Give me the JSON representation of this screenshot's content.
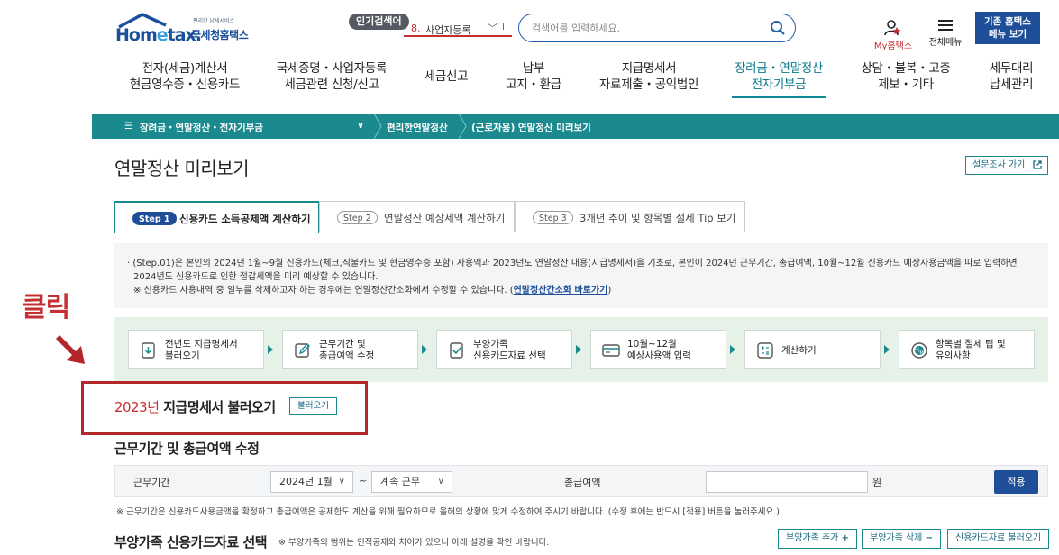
{
  "header": {
    "logo_word": "Hometax",
    "logo_kr": "국세청홈택스",
    "logo_tagline": "편리한 납세서비스",
    "popular_badge": "인기검색어",
    "popular_rank": "8.",
    "popular_term": "사업자등록",
    "search_placeholder": "검색어를 입력하세요.",
    "my_home": "My홈택스",
    "all_menu": "전체메뉴",
    "old_menu_line1": "기존 홈택스",
    "old_menu_line2": "메뉴 보기"
  },
  "nav": [
    {
      "l1": "전자(세금)계산서",
      "l2": "현금영수증・신용카드"
    },
    {
      "l1": "국세증명・사업자등록",
      "l2": "세금관련 신청/신고"
    },
    {
      "l1": "세금신고",
      "l2": ""
    },
    {
      "l1": "납부",
      "l2": "고지・환급"
    },
    {
      "l1": "지급명세서",
      "l2": "자료제출・공익법인"
    },
    {
      "l1": "장려금・연말정산",
      "l2": "전자기부금"
    },
    {
      "l1": "상담・불복・고충",
      "l2": "제보・기타"
    },
    {
      "l1": "세무대리",
      "l2": "납세관리"
    }
  ],
  "breadcrumb": {
    "menu": "장려금・연말정산・전자기부금",
    "item2": "편리한연말정산",
    "item3": "(근로자용) 연말정산 미리보기"
  },
  "page": {
    "title": "연말정산 미리보기",
    "survey": "설문조사 가기"
  },
  "tabs": [
    {
      "step": "Step 1",
      "label": "신용카드 소득공제액 계산하기"
    },
    {
      "step": "Step 2",
      "label": "연말정산 예상세액 계산하기"
    },
    {
      "step": "Step 3",
      "label": "3개년 추이 및 항목별 절세 Tip 보기"
    }
  ],
  "info": {
    "line1": "(Step.01)은 본인의 2024년 1월~9월 신용카드(체크,직불카드 및 현금영수증 포함) 사용액과 2023년도 연말정산 내용(지급명세서)을 기초로, 본인이 2024년 근무기간, 총급여액, 10월~12월 신용카드 예상사용금액을 따로 입력하면",
    "line2": "2024년도 신용카드로 인한 절감세액을 미리 예상할 수 있습니다.",
    "line3": "※ 신용카드 사용내역 중 일부를 삭제하고자 하는 경우에는 연말정산간소화에서 수정할 수 있습니다.",
    "link": "연말정산간소화 바로가기"
  },
  "annotation": {
    "text": "클릭"
  },
  "steps": [
    {
      "l1": "전년도 지급명세서",
      "l2": "불러오기"
    },
    {
      "l1": "근무기간 및",
      "l2": "총급여액 수정"
    },
    {
      "l1": "부양가족",
      "l2": "신용카드자료 선택"
    },
    {
      "l1": "10월~12월",
      "l2": "예상사용액 입력"
    },
    {
      "l1": "계산하기",
      "l2": ""
    },
    {
      "l1": "항목별 절세 팁 및",
      "l2": "유의사항"
    }
  ],
  "section1": {
    "year": "2023년",
    "title": "지급명세서 불러오기",
    "button": "불러오기"
  },
  "section2": {
    "title": "근무기간 및 총급여액 수정",
    "period_label": "근무기간",
    "start_value": "2024년 1월",
    "tilde": "~",
    "end_value": "계속 근무",
    "salary_label": "총급여액",
    "salary_value": "",
    "unit": "원",
    "apply": "적용",
    "note": "※ 근무기간은 신용카드사용금액을 확정하고 총급여액은 공제한도 계산을 위해 필요하므로 올해의 상황에 맞게 수정하여 주시기 바랍니다. (수정 후에는 반드시 [적용] 버튼을 눌러주세요.)"
  },
  "section3": {
    "title": "부양가족 신용카드자료 선택",
    "note": "※ 부양가족의 범위는 인적공제와 차이가 있으니 아래 설명을 확인 바랍니다.",
    "add": "부양가족 추가",
    "del": "부양가족 삭제",
    "load": "신용카드자료 불러오기"
  },
  "colors": {
    "teal": "#1a8a8f",
    "navy": "#1f4e98",
    "red": "#c62f2f"
  }
}
